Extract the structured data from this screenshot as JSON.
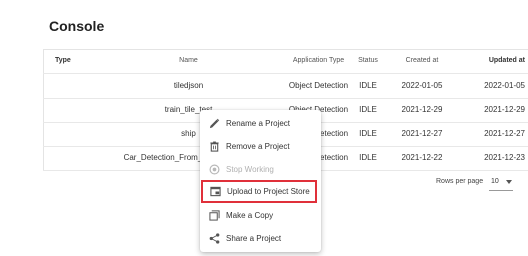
{
  "page": {
    "title": "Console"
  },
  "table": {
    "headers": {
      "type": "Type",
      "name": "Name",
      "app_type": "Application Type",
      "status": "Status",
      "created": "Created at",
      "updated": "Updated at"
    },
    "rows": [
      {
        "name": "tiledjson",
        "app_type": "Object Detection",
        "status": "IDLE",
        "created": "2022-01-05",
        "updated": "2022-01-05"
      },
      {
        "name": "train_tile_test",
        "app_type": "Object Detection",
        "status": "IDLE",
        "created": "2021-12-29",
        "updated": "2021-12-29"
      },
      {
        "name": "ship",
        "app_type": "Object Detection",
        "status": "IDLE",
        "created": "2021-12-27",
        "updated": "2021-12-27"
      },
      {
        "name": "Car_Detection_From_Aerial_Images",
        "app_type": "Object Detection",
        "status": "IDLE",
        "created": "2021-12-22",
        "updated": "2021-12-23"
      }
    ]
  },
  "pagination": {
    "rows_per_page_label": "Rows per page",
    "rows_per_page_value": "10"
  },
  "context_menu": {
    "items": [
      {
        "label": "Rename a Project",
        "icon": "pencil-icon",
        "disabled": false
      },
      {
        "label": "Remove a Project",
        "icon": "trash-icon",
        "disabled": false
      },
      {
        "label": "Stop Working",
        "icon": "stop-circle-icon",
        "disabled": true
      },
      {
        "label": "Upload to Project Store",
        "icon": "upload-box-icon",
        "disabled": false,
        "highlighted": true,
        "highlight_color": "#e0303a"
      },
      {
        "label": "Make a Copy",
        "icon": "copy-icon",
        "disabled": false
      },
      {
        "label": "Share a Project",
        "icon": "share-icon",
        "disabled": false
      }
    ]
  },
  "colors": {
    "highlight": "#e0303a",
    "disabled_text": "#b0b0b0"
  }
}
